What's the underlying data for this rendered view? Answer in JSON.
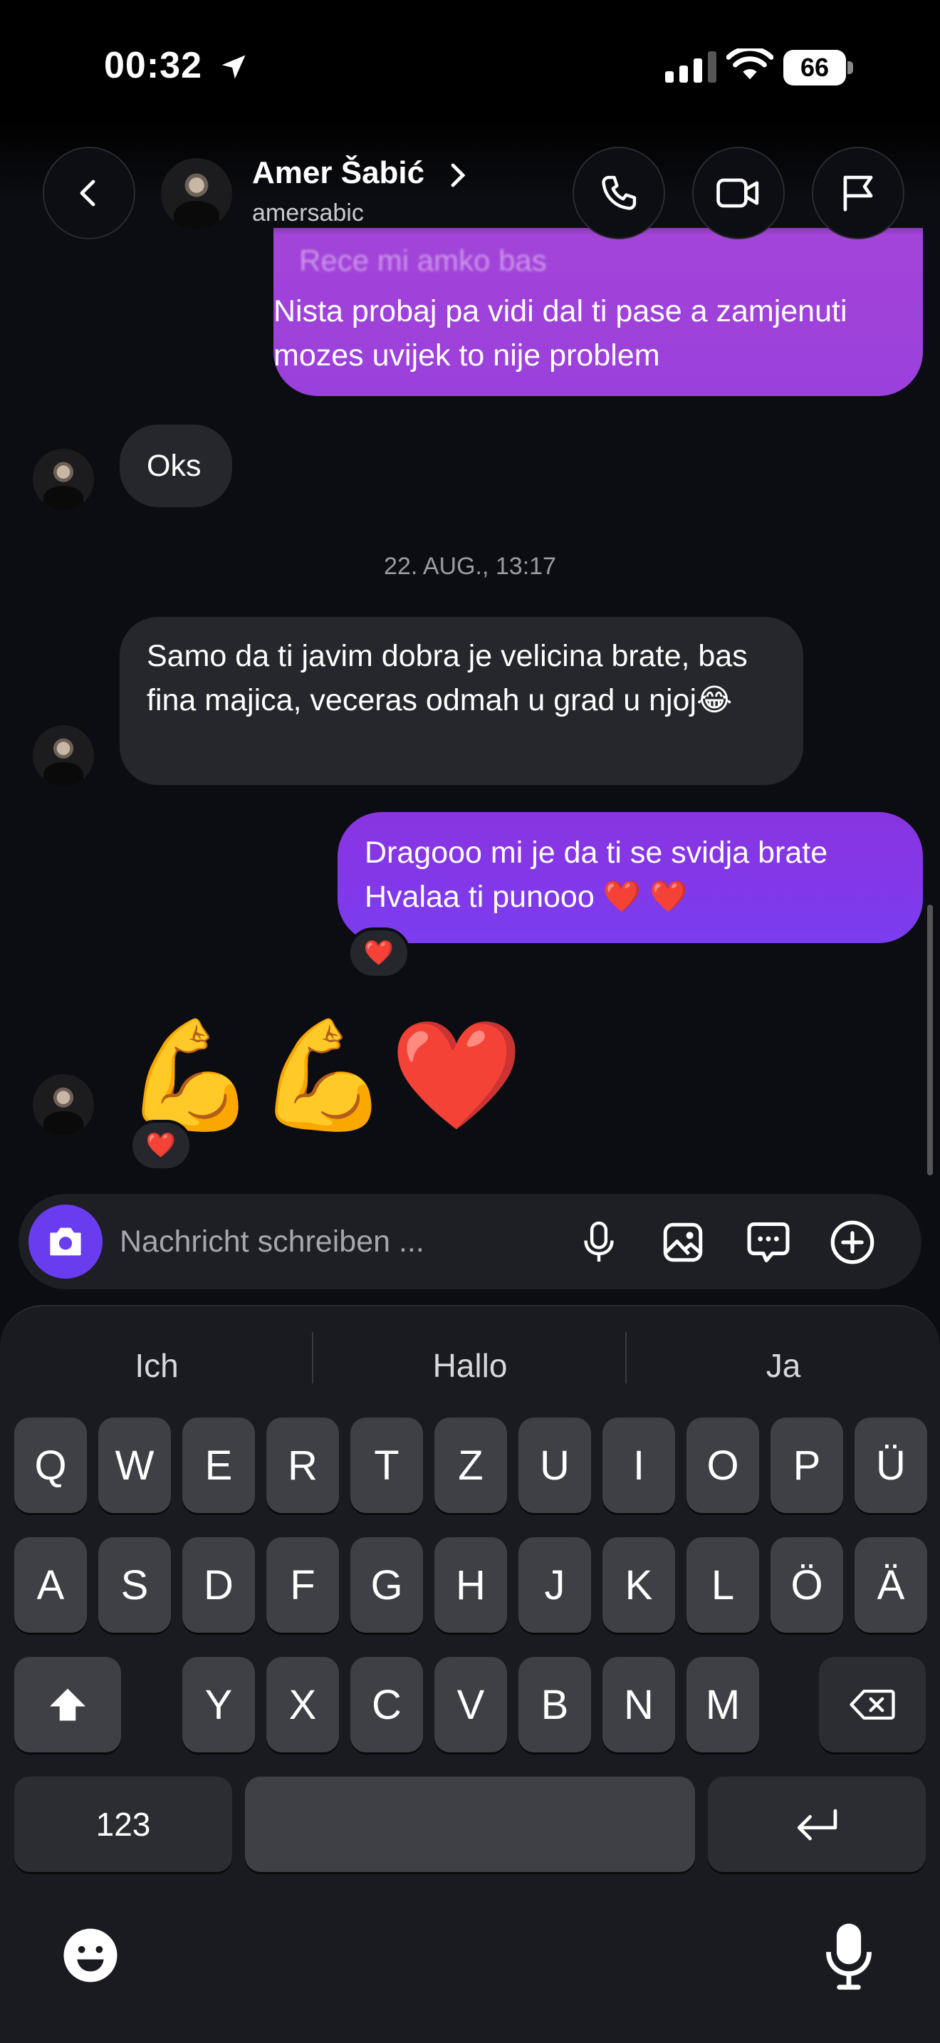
{
  "status_bar": {
    "time": "00:32",
    "battery": "66"
  },
  "header": {
    "name": "Amer Šabić",
    "username": "amersabic"
  },
  "messages": {
    "m1_faded": "Rece mi amko bas",
    "m1_text": "Nista probaj pa vidi dal ti pase a zamjenuti mozes uvijek to nije problem",
    "m2_text": "Oks",
    "timestamp": "22. AUG., 13:17",
    "m3_text": "Samo da ti javim dobra je velicina brate, bas fina majica, veceras odmah u grad u njoj😂",
    "m4_text": "Dragooo mi je da ti se svidja brate Hvalaa ti punooo ❤️ ❤️",
    "m4_reaction": "❤️",
    "m5_text": "💪💪❤️",
    "m5_reaction": "❤️"
  },
  "composer": {
    "placeholder": "Nachricht schreiben ..."
  },
  "keyboard": {
    "suggestions": [
      "Ich",
      "Hallo",
      "Ja"
    ],
    "row1": [
      "Q",
      "W",
      "E",
      "R",
      "T",
      "Z",
      "U",
      "I",
      "O",
      "P",
      "Ü"
    ],
    "row2": [
      "A",
      "S",
      "D",
      "F",
      "G",
      "H",
      "J",
      "K",
      "L",
      "Ö",
      "Ä"
    ],
    "row3": [
      "Y",
      "X",
      "C",
      "V",
      "B",
      "N",
      "M"
    ],
    "numbers_key": "123"
  },
  "colors": {
    "accent": "#7b3cf0",
    "outgoing_bubble": "#8a34e0",
    "incoming_bubble": "#26272c",
    "background": "#0c0d12"
  },
  "icons": [
    "location-arrow-icon",
    "signal-icon",
    "wifi-icon",
    "battery-icon",
    "back-chevron-icon",
    "phone-icon",
    "video-icon",
    "flag-icon",
    "camera-icon",
    "microphone-icon",
    "image-icon",
    "sticker-icon",
    "plus-circle-icon",
    "shift-icon",
    "backspace-icon",
    "return-icon",
    "emoji-icon",
    "dictation-mic-icon"
  ]
}
